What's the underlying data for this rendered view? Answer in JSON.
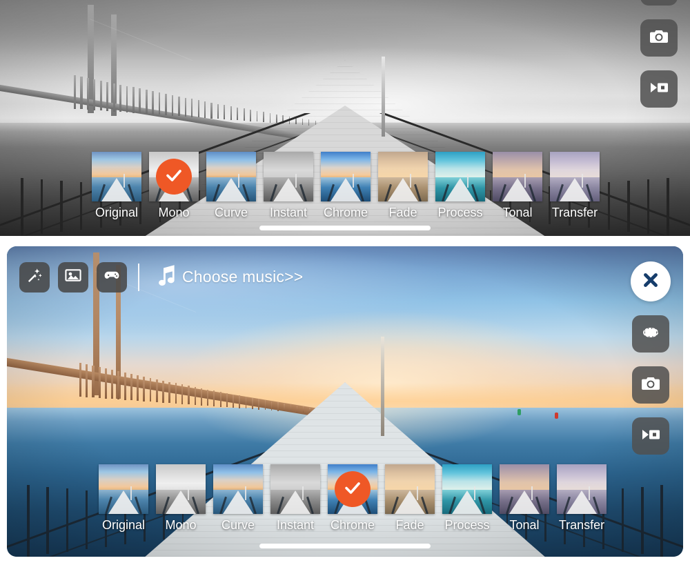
{
  "app": {
    "accent_orange": "#ef5826",
    "close_x_color": "#163d6b",
    "button_bg": "rgba(80,80,80,0.86)"
  },
  "top_panel": {
    "name": "mono-filter-preview",
    "selected_filter": "Mono",
    "right_rail": [
      {
        "icon": "rotate-frame-icon",
        "label": "Rotate"
      },
      {
        "icon": "camera-icon",
        "label": "Camera"
      },
      {
        "icon": "video-camera-icon",
        "label": "Video"
      }
    ],
    "filters": [
      {
        "label": "Original",
        "selected": false,
        "sky": "linear-gradient(to bottom,#6f93c3 0%,#9dc6e4 30%,#d9cfc4 60%,#f2c89c 88%,#e6b882 100%)",
        "water": "linear-gradient(to bottom,#8fb4cf 0%,#4e85ad 40%,#2c5c80 100%)"
      },
      {
        "label": "Mono",
        "selected": true,
        "sky": "linear-gradient(to bottom,#c8c8c8 0%,#dedede 40%,#efefef 75%,#e2e2e2 100%)",
        "water": "linear-gradient(to bottom,#bdbdbd 0%,#8c8c8c 45%,#5e5e5e 100%)"
      },
      {
        "label": "Curve",
        "selected": false,
        "sky": "linear-gradient(to bottom,#5f8ec6 0%,#8fc0e8 32%,#dbd1c6 62%,#f0c79b 90%,#e0b07c 100%)",
        "water": "linear-gradient(to bottom,#8db5d2 0%,#4a82ab 42%,#27567a 100%)"
      },
      {
        "label": "Instant",
        "selected": false,
        "sky": "linear-gradient(to bottom,#a9a9a9 0%,#c4c4c4 38%,#d9d9d9 72%,#cfcfcf 100%)",
        "water": "linear-gradient(to bottom,#b2b2b2 0%,#888888 45%,#5c5c5c 100%)"
      },
      {
        "label": "Chrome",
        "selected": false,
        "sky": "linear-gradient(to bottom,#3f7ec9 0%,#7cb6e8 30%,#dcd4cb 62%,#f5cb9d 90%,#e9b87f 100%)",
        "water": "linear-gradient(to bottom,#9dc4dd 0%,#3f81b4 42%,#1e4e78 100%)"
      },
      {
        "label": "Fade",
        "selected": false,
        "sky": "linear-gradient(to bottom,#c0a78e 0%,#dcc0a0 34%,#f0d3ad 66%,#f6d6a9 100%)",
        "water": "linear-gradient(to bottom,#cdb79c 0%,#a9906f 45%,#7d6a50 100%)"
      },
      {
        "label": "Process",
        "selected": false,
        "sky": "linear-gradient(to bottom,#2ea0c4 0%,#62c4dc 34%,#b9e3e8 66%,#dff0ea 100%)",
        "water": "linear-gradient(to bottom,#7fd0d8 0%,#2f95a6 45%,#176b7c 100%)"
      },
      {
        "label": "Tonal",
        "selected": false,
        "sky": "linear-gradient(to bottom,#9a8fa8 0%,#bfa9ab 36%,#e0c3ab 70%,#e8c6a4 100%)",
        "water": "linear-gradient(to bottom,#a79cb0 0%,#77708a 45%,#4f4a63 100%)"
      },
      {
        "label": "Transfer",
        "selected": false,
        "sky": "linear-gradient(to bottom,#a7a2c0 0%,#c4bcd2 36%,#ded5dc 70%,#e7dcd8 100%)",
        "water": "linear-gradient(to bottom,#b3adc2 0%,#8a85a0 45%,#64607c 100%)"
      }
    ]
  },
  "bottom_panel": {
    "name": "color-filter-preview",
    "selected_filter": "Chrome",
    "toolbar": [
      {
        "icon": "magic-wand-icon",
        "label": "Effects"
      },
      {
        "icon": "photo-icon",
        "label": "Photos"
      },
      {
        "icon": "game-controller-icon",
        "label": "Games"
      }
    ],
    "music": {
      "icon": "music-note-icon",
      "label": "Choose music>>"
    },
    "close": {
      "icon": "close-icon",
      "label": "Close"
    },
    "right_rail": [
      {
        "icon": "rotate-frame-icon",
        "label": "Rotate"
      },
      {
        "icon": "camera-icon",
        "label": "Camera"
      },
      {
        "icon": "video-camera-icon",
        "label": "Video"
      }
    ],
    "filters": [
      {
        "label": "Original",
        "selected": false,
        "sky": "linear-gradient(to bottom,#6f93c3 0%,#9dc6e4 30%,#d9cfc4 60%,#f2c89c 88%,#e6b882 100%)",
        "water": "linear-gradient(to bottom,#8fb4cf 0%,#4e85ad 40%,#2c5c80 100%)"
      },
      {
        "label": "Mono",
        "selected": false,
        "sky": "linear-gradient(to bottom,#c8c8c8 0%,#dedede 40%,#efefef 75%,#e2e2e2 100%)",
        "water": "linear-gradient(to bottom,#bdbdbd 0%,#8c8c8c 45%,#5e5e5e 100%)"
      },
      {
        "label": "Curve",
        "selected": false,
        "sky": "linear-gradient(to bottom,#5f8ec6 0%,#8fc0e8 32%,#dbd1c6 62%,#f0c79b 90%,#e0b07c 100%)",
        "water": "linear-gradient(to bottom,#8db5d2 0%,#4a82ab 42%,#27567a 100%)"
      },
      {
        "label": "Instant",
        "selected": false,
        "sky": "linear-gradient(to bottom,#a9a9a9 0%,#c4c4c4 38%,#d9d9d9 72%,#cfcfcf 100%)",
        "water": "linear-gradient(to bottom,#b2b2b2 0%,#888888 45%,#5c5c5c 100%)"
      },
      {
        "label": "Chrome",
        "selected": true,
        "sky": "linear-gradient(to bottom,#3f7ec9 0%,#7cb6e8 30%,#dcd4cb 62%,#f5cb9d 90%,#e9b87f 100%)",
        "water": "linear-gradient(to bottom,#9dc4dd 0%,#3f81b4 42%,#1e4e78 100%)"
      },
      {
        "label": "Fade",
        "selected": false,
        "sky": "linear-gradient(to bottom,#c0a78e 0%,#dcc0a0 34%,#f0d3ad 66%,#f6d6a9 100%)",
        "water": "linear-gradient(to bottom,#cdb79c 0%,#a9906f 45%,#7d6a50 100%)"
      },
      {
        "label": "Process",
        "selected": false,
        "sky": "linear-gradient(to bottom,#2ea0c4 0%,#62c4dc 34%,#b9e3e8 66%,#dff0ea 100%)",
        "water": "linear-gradient(to bottom,#7fd0d8 0%,#2f95a6 45%,#176b7c 100%)"
      },
      {
        "label": "Tonal",
        "selected": false,
        "sky": "linear-gradient(to bottom,#9a8fa8 0%,#bfa9ab 36%,#e0c3ab 70%,#e8c6a4 100%)",
        "water": "linear-gradient(to bottom,#a79cb0 0%,#77708a 45%,#4f4a63 100%)"
      },
      {
        "label": "Transfer",
        "selected": false,
        "sky": "linear-gradient(to bottom,#a7a2c0 0%,#c4bcd2 36%,#ded5dc 70%,#e7dcd8 100%)",
        "water": "linear-gradient(to bottom,#b3adc2 0%,#8a85a0 45%,#64607c 100%)"
      }
    ]
  }
}
